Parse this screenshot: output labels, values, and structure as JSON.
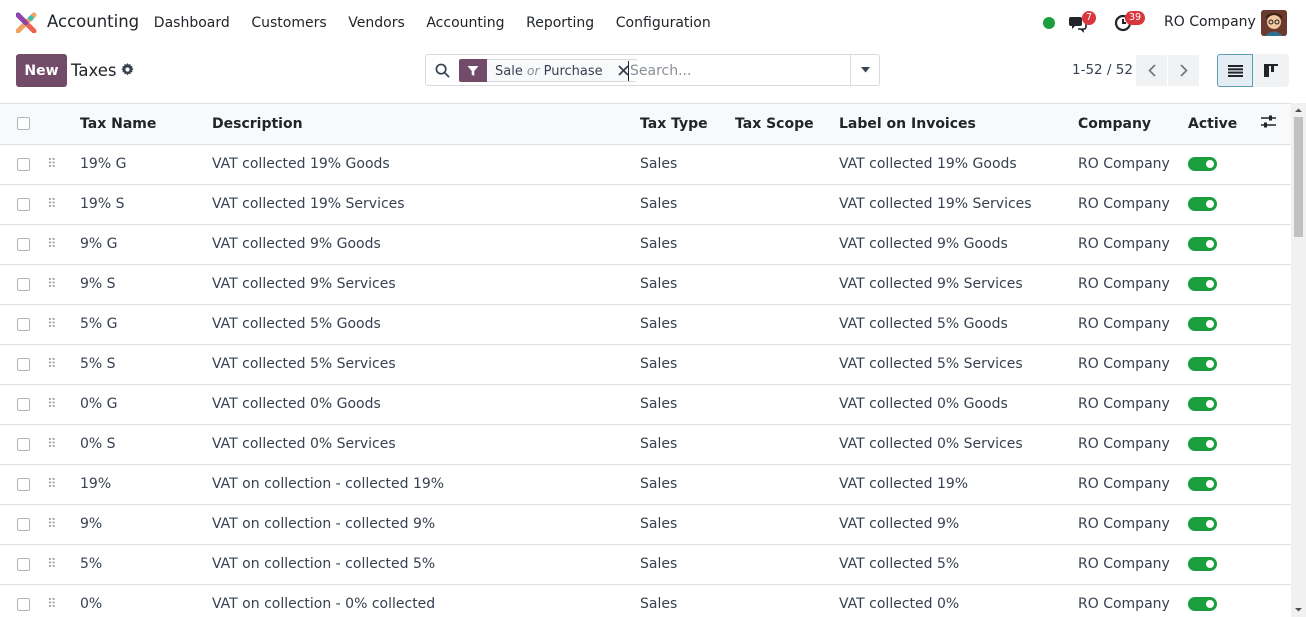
{
  "app": {
    "name": "Accounting"
  },
  "menu": [
    "Dashboard",
    "Customers",
    "Vendors",
    "Accounting",
    "Reporting",
    "Configuration"
  ],
  "systray": {
    "messages_count": "7",
    "activities_count": "39",
    "company": "RO Company"
  },
  "control_panel": {
    "new_label": "New",
    "title": "Taxes",
    "search": {
      "facet_value_1": "Sale",
      "facet_or": "or",
      "facet_value_2": "Purchase",
      "placeholder": "Search..."
    },
    "pager": "1-52 / 52"
  },
  "table": {
    "columns": [
      "Tax Name",
      "Description",
      "Tax Type",
      "Tax Scope",
      "Label on Invoices",
      "Company",
      "Active"
    ],
    "rows": [
      {
        "name": "19% G",
        "description": "VAT collected 19% Goods",
        "type": "Sales",
        "scope": "",
        "label": "VAT collected 19% Goods",
        "company": "RO Company",
        "active": true
      },
      {
        "name": "19% S",
        "description": "VAT collected 19% Services",
        "type": "Sales",
        "scope": "",
        "label": "VAT collected 19% Services",
        "company": "RO Company",
        "active": true
      },
      {
        "name": "9% G",
        "description": "VAT collected 9% Goods",
        "type": "Sales",
        "scope": "",
        "label": "VAT collected 9% Goods",
        "company": "RO Company",
        "active": true
      },
      {
        "name": "9% S",
        "description": "VAT collected 9% Services",
        "type": "Sales",
        "scope": "",
        "label": "VAT collected 9% Services",
        "company": "RO Company",
        "active": true
      },
      {
        "name": "5% G",
        "description": "VAT collected 5% Goods",
        "type": "Sales",
        "scope": "",
        "label": "VAT collected 5% Goods",
        "company": "RO Company",
        "active": true
      },
      {
        "name": "5% S",
        "description": "VAT collected 5% Services",
        "type": "Sales",
        "scope": "",
        "label": "VAT collected 5% Services",
        "company": "RO Company",
        "active": true
      },
      {
        "name": "0% G",
        "description": "VAT collected 0% Goods",
        "type": "Sales",
        "scope": "",
        "label": "VAT collected 0% Goods",
        "company": "RO Company",
        "active": true
      },
      {
        "name": "0% S",
        "description": "VAT collected 0% Services",
        "type": "Sales",
        "scope": "",
        "label": "VAT collected 0% Services",
        "company": "RO Company",
        "active": true
      },
      {
        "name": "19%",
        "description": "VAT on collection - collected 19%",
        "type": "Sales",
        "scope": "",
        "label": "VAT collected 19%",
        "company": "RO Company",
        "active": true
      },
      {
        "name": "9%",
        "description": "VAT on collection - collected 9%",
        "type": "Sales",
        "scope": "",
        "label": "VAT collected 9%",
        "company": "RO Company",
        "active": true
      },
      {
        "name": "5%",
        "description": "VAT on collection - collected 5%",
        "type": "Sales",
        "scope": "",
        "label": "VAT collected 5%",
        "company": "RO Company",
        "active": true
      },
      {
        "name": "0%",
        "description": "VAT on collection - 0% collected",
        "type": "Sales",
        "scope": "",
        "label": "VAT collected 0%",
        "company": "RO Company",
        "active": true
      }
    ]
  },
  "icons": {
    "app_logo": "odoo-accounting-logo-icon",
    "settings": "gear-icon",
    "search": "search-icon",
    "filter": "filter-icon",
    "remove": "close-icon",
    "dropdown": "caret-down-icon",
    "prev": "chevron-left-icon",
    "next": "chevron-right-icon",
    "list_view": "list-view-icon",
    "kanban_view": "kanban-view-icon",
    "messages": "chat-bubbles-icon",
    "activities": "clock-icon",
    "optional_columns": "sliders-icon"
  },
  "colors": {
    "brand": "#714b67",
    "active_toggle": "#1b9e3e",
    "badge": "#d9363e",
    "presence": "#1b9e3e"
  }
}
